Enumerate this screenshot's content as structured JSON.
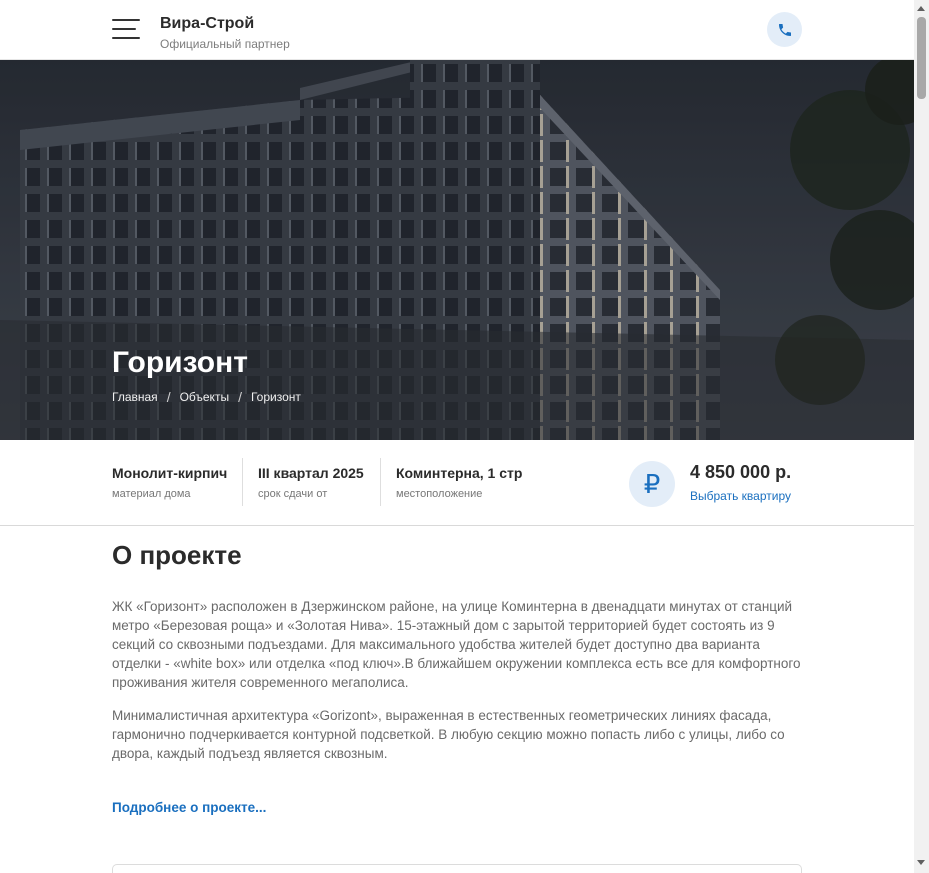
{
  "header": {
    "brand_title": "Вира-Строй",
    "brand_subtitle": "Официальный партнер",
    "menu_icon": "hamburger-menu-icon",
    "phone_icon": "phone-icon"
  },
  "hero": {
    "title": "Горизонт",
    "breadcrumbs": [
      "Главная",
      "Объекты",
      "Горизонт"
    ],
    "separator": "/"
  },
  "info": [
    {
      "value": "Монолит-кирпич",
      "label": "материал дома"
    },
    {
      "value": "III квартал 2025",
      "label": "срок сдачи от"
    },
    {
      "value": "Коминтерна, 1 стр",
      "label": "местоположение"
    }
  ],
  "price": {
    "icon": "ruble-icon",
    "symbol": "₽",
    "value": "4 850 000 р.",
    "link": "Выбрать квартиру"
  },
  "about": {
    "title": "О проекте",
    "paragraphs": [
      "ЖК «Горизонт» расположен в Дзержинском районе, на улице Коминтерна в двенадцати минутах от станций метро «Березовая роща» и «Золотая Нива». 15-этажный дом с зарытой территорией будет состоять из 9 секций со сквозными подъездами. Для максимального удобства жителей будет доступно два варианта отделки - «white box» или отделка «под ключ».В ближайшем окружении комплекса есть все для комфортного проживания жителя современного мегаполиса.",
      "Минималистичная архитектура «Gorizont», выраженная в естественных геометрических линиях фасада, гармонично подчеркивается контурной подсветкой. В любую секцию можно попасть либо с улицы, либо со двора, каждый подъезд является сквозным."
    ],
    "more_link": "Подробнее о проекте..."
  },
  "colors": {
    "accent": "#1a6fbf",
    "accent_bg": "#e3edf8",
    "text": "#2b2b2b",
    "muted": "#6a6a6a"
  }
}
